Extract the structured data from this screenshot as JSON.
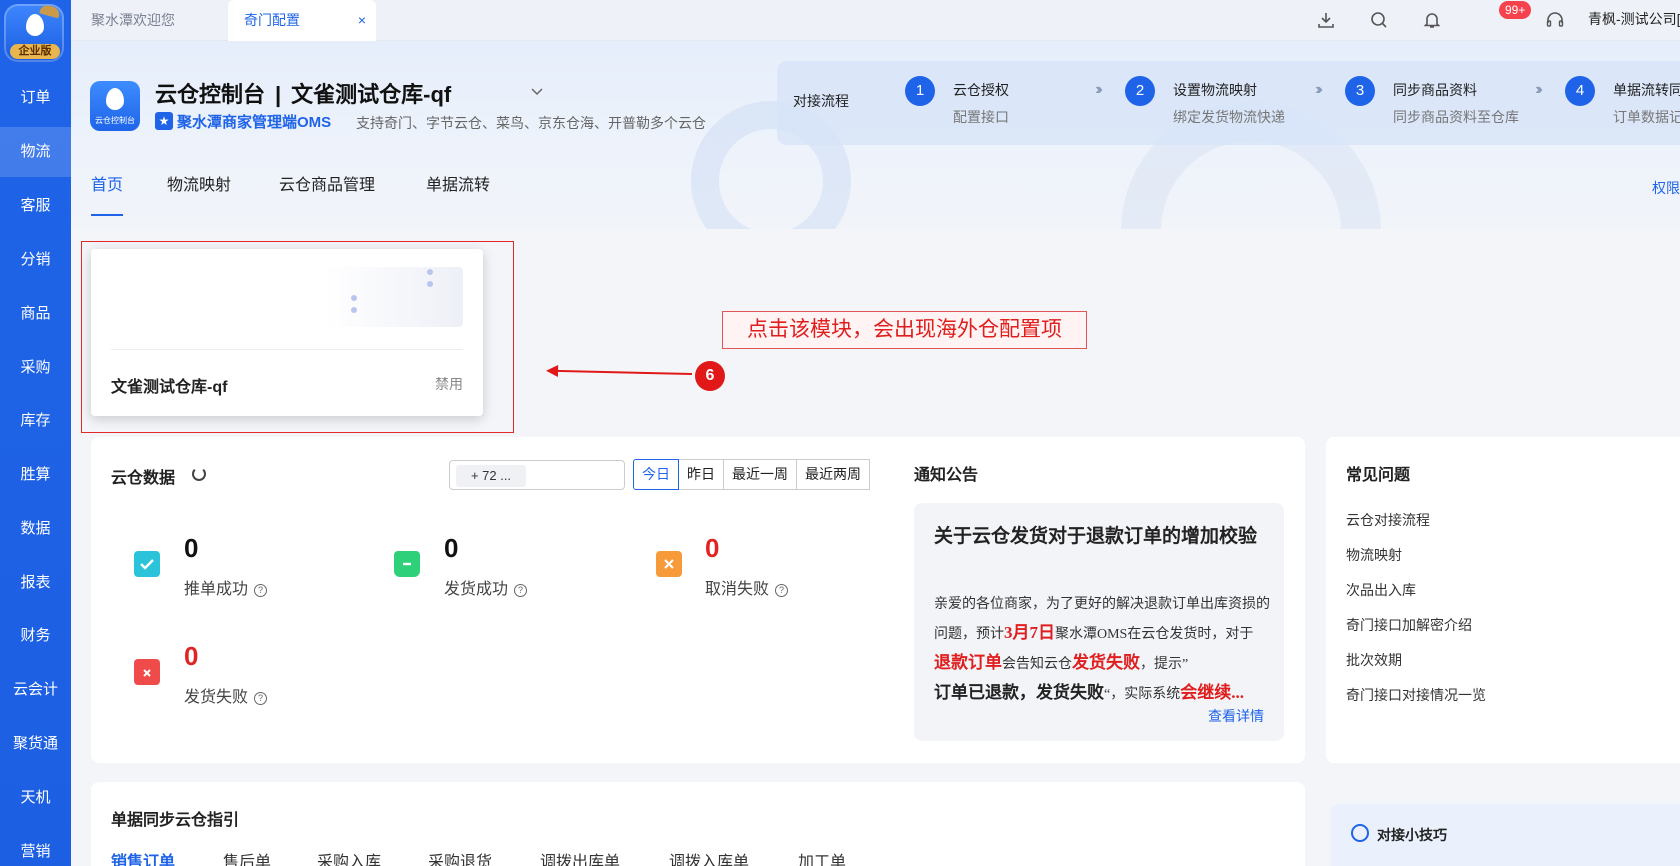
{
  "sidebar": {
    "logo_badge": "企业版",
    "items": [
      {
        "label": "订单",
        "active": false
      },
      {
        "label": "物流",
        "active": true
      },
      {
        "label": "客服",
        "active": false
      },
      {
        "label": "分销",
        "active": false
      },
      {
        "label": "商品",
        "active": false
      },
      {
        "label": "采购",
        "active": false
      },
      {
        "label": "库存",
        "active": false
      },
      {
        "label": "胜算",
        "active": false
      },
      {
        "label": "数据",
        "active": false
      },
      {
        "label": "报表",
        "active": false
      },
      {
        "label": "财务",
        "active": false
      },
      {
        "label": "云会计",
        "active": false
      },
      {
        "label": "聚货通",
        "active": false
      },
      {
        "label": "天机",
        "active": false
      },
      {
        "label": "营销",
        "active": false
      }
    ]
  },
  "topbar": {
    "tabs": [
      {
        "label": "聚水潭欢迎您",
        "active": false
      },
      {
        "label": "奇门配置",
        "active": true,
        "close": "×"
      }
    ],
    "icons": [
      "download-icon",
      "search-icon",
      "bell-icon",
      "headset-icon"
    ],
    "notification_badge": "99+",
    "user": "青枫-测试公司[qingfeng"
  },
  "header": {
    "app_logo_text": "云仓控制台",
    "title": "云仓控制台",
    "separator": "|",
    "warehouse": "文雀测试仓库-qf",
    "brand": "聚水潭商家管理端OMS",
    "description": "支持奇门、字节云仓、菜鸟、京东仓海、开普勒多个云仓",
    "flow": {
      "label": "对接流程",
      "steps": [
        {
          "num": "1",
          "title": "云仓授权",
          "sub": "配置接口"
        },
        {
          "num": "2",
          "title": "设置物流映射",
          "sub": "绑定发货物流快递"
        },
        {
          "num": "3",
          "title": "同步商品资料",
          "sub": "同步商品资料至仓库"
        },
        {
          "num": "4",
          "title": "单据流转同",
          "sub": "订单数据记"
        }
      ]
    },
    "tabs": [
      {
        "label": "首页",
        "active": true
      },
      {
        "label": "物流映射",
        "active": false
      },
      {
        "label": "云仓商品管理",
        "active": false
      },
      {
        "label": "单据流转",
        "active": false
      }
    ],
    "permission_link": "权限"
  },
  "warehouse_card": {
    "name": "文雀测试仓库-qf",
    "status": "禁用"
  },
  "annotation": {
    "text": "点击该模块，会出现海外仓配置项",
    "number": "6"
  },
  "cloud_data": {
    "title": "云仓数据",
    "search_chip": "+ 72 ...",
    "ranges": [
      {
        "label": "今日",
        "active": true
      },
      {
        "label": "昨日",
        "active": false
      },
      {
        "label": "最近一周",
        "active": false
      },
      {
        "label": "最近两周",
        "active": false
      }
    ],
    "stats": [
      {
        "value": "0",
        "label": "推单成功",
        "color": "#2bc3d9"
      },
      {
        "value": "0",
        "label": "发货成功",
        "color": "#2fd07a"
      },
      {
        "value": "0",
        "label": "取消失败",
        "color": "#f79b3a"
      },
      {
        "value": "0",
        "label": "发货失败",
        "color": "#ef4b4b"
      }
    ],
    "help_glyph": "?"
  },
  "notice": {
    "section_title": "通知公告",
    "title": "关于云仓发货对于退款订单的增加校验",
    "body": {
      "p1": "亲爱的各位商家，为了更好的解决退款订单出库资损的问题，预计",
      "date": "3月7日",
      "p2": "聚水潭OMS在云仓发货时，对于",
      "refund": "退款订单",
      "p3": "会告知云仓",
      "fail": "发货失败",
      "p4": "，提示”",
      "quote": "订单已退款，发货失败",
      "p5": "“，实际系统",
      "cont": "会继续..."
    },
    "more": "查看详情"
  },
  "faq": {
    "title": "常见问题",
    "items": [
      "云仓对接流程",
      "物流映射",
      "次品出入库",
      "奇门接口加解密介绍",
      "批次效期",
      "奇门接口对接情况一览"
    ]
  },
  "guide": {
    "title": "单据同步云仓指引",
    "tabs": [
      {
        "label": "销售订单",
        "active": true
      },
      {
        "label": "售后单",
        "active": false
      },
      {
        "label": "采购入库",
        "active": false
      },
      {
        "label": "采购退货",
        "active": false
      },
      {
        "label": "调拨出库单",
        "active": false
      },
      {
        "label": "调拨入库单",
        "active": false
      },
      {
        "label": "加工单",
        "active": false
      }
    ]
  },
  "tips": {
    "title": "对接小技巧"
  }
}
